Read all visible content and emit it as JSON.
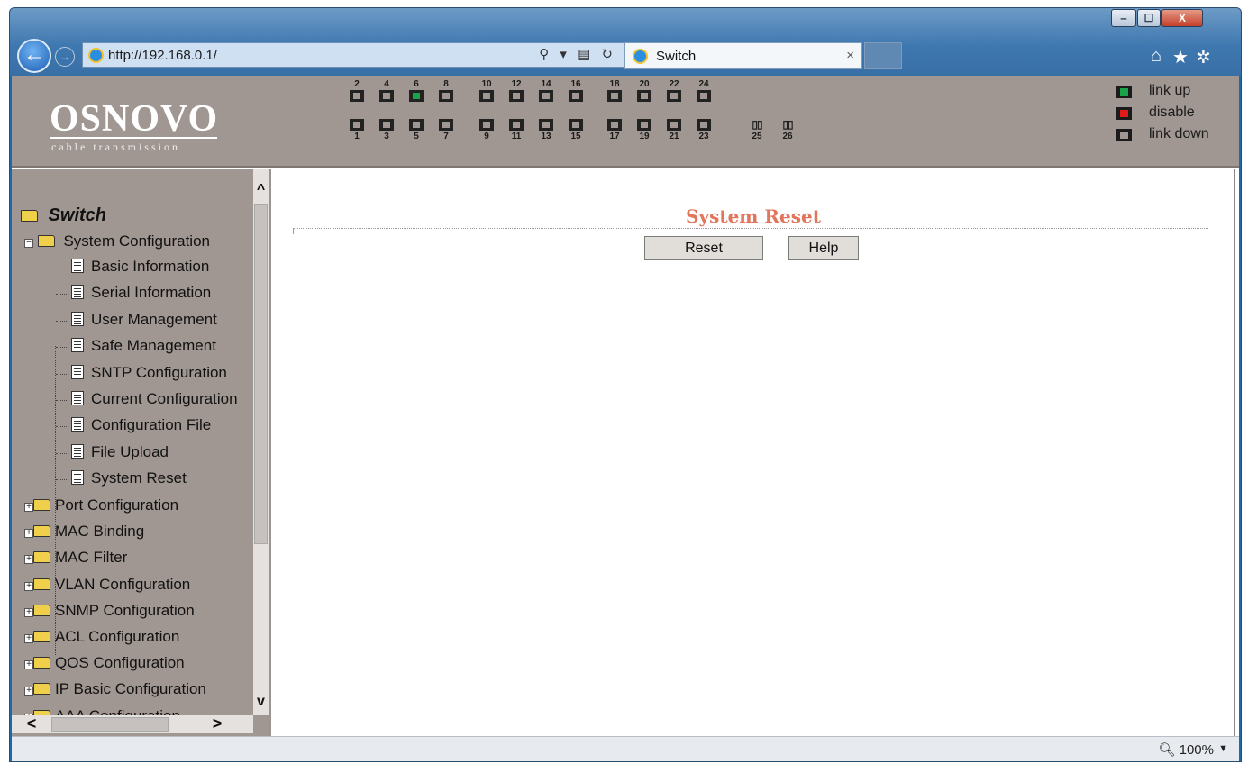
{
  "browser": {
    "url": "http://192.168.0.1/",
    "tab_title": "Switch",
    "tab_close": "×",
    "window_min": "‒",
    "window_max": "☐",
    "window_close": "X",
    "back": "←",
    "forward": "→",
    "addr_controls": "⚲ ▾ ▤ ↻",
    "home_icon": "⌂",
    "favorites_icon": "★",
    "tools_icon": "✲",
    "zoom": "100%",
    "zoom_caret": "▼"
  },
  "header": {
    "logo": "OSNOVO",
    "logo_sub": "cable transmission",
    "ports_top": [
      {
        "num": "2",
        "state": "down"
      },
      {
        "num": "4",
        "state": "down"
      },
      {
        "num": "6",
        "state": "up"
      },
      {
        "num": "8",
        "state": "down"
      },
      {
        "num": "10",
        "state": "down"
      },
      {
        "num": "12",
        "state": "down"
      },
      {
        "num": "14",
        "state": "down"
      },
      {
        "num": "16",
        "state": "down"
      },
      {
        "num": "18",
        "state": "down"
      },
      {
        "num": "20",
        "state": "down"
      },
      {
        "num": "22",
        "state": "down"
      },
      {
        "num": "24",
        "state": "down"
      }
    ],
    "ports_bottom": [
      {
        "num": "1",
        "state": "down"
      },
      {
        "num": "3",
        "state": "down"
      },
      {
        "num": "5",
        "state": "down"
      },
      {
        "num": "7",
        "state": "down"
      },
      {
        "num": "9",
        "state": "down"
      },
      {
        "num": "11",
        "state": "down"
      },
      {
        "num": "13",
        "state": "down"
      },
      {
        "num": "15",
        "state": "down"
      },
      {
        "num": "17",
        "state": "down"
      },
      {
        "num": "19",
        "state": "down"
      },
      {
        "num": "21",
        "state": "down"
      },
      {
        "num": "23",
        "state": "down"
      }
    ],
    "sfp_ports": [
      "25",
      "26"
    ],
    "legend": [
      {
        "label": "link up",
        "color": "#19a44a"
      },
      {
        "label": "disable",
        "color": "#e21b1b"
      },
      {
        "label": "link down",
        "color": "#a19792"
      }
    ]
  },
  "nav": {
    "root": "Switch",
    "system_config": "System Configuration",
    "system_children": [
      "Basic Information",
      "Serial Information",
      "User Management",
      "Safe Management",
      "SNTP Configuration",
      "Current Configuration",
      "Configuration File",
      "File Upload",
      "System Reset"
    ],
    "folders": [
      "Port Configuration",
      "MAC Binding",
      "MAC Filter",
      "VLAN Configuration",
      "SNMP Configuration",
      "ACL Configuration",
      "QOS Configuration",
      "IP Basic Configuration",
      "AAA Configuration"
    ],
    "scroll_up": "^",
    "scroll_down": "v",
    "scroll_left": "<",
    "scroll_right": ">"
  },
  "content": {
    "title": "System Reset",
    "reset_label": "Reset",
    "help_label": "Help"
  }
}
